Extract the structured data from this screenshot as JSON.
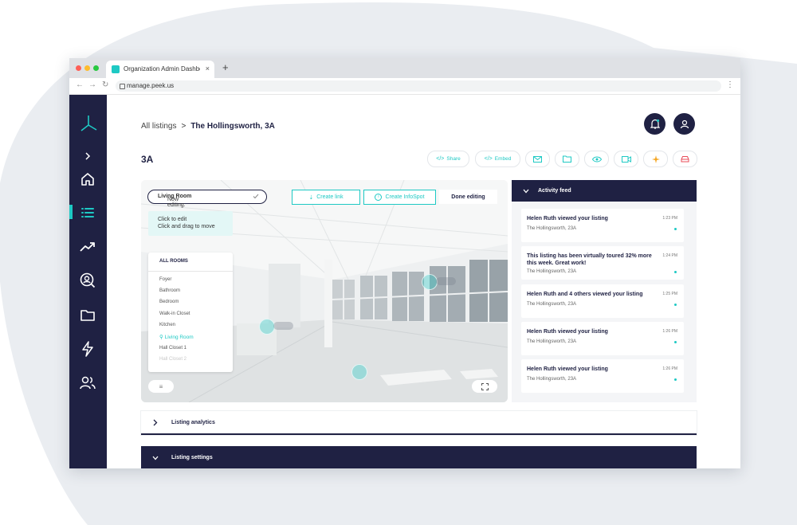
{
  "browser": {
    "tab_title": "Organization Admin Dashbo",
    "tab_close": "×",
    "new_tab": "+",
    "url": "manage.peek.us",
    "menu": "⋮"
  },
  "sidebar": {
    "items": [
      {
        "icon": "chevron-right-icon"
      },
      {
        "icon": "home-icon"
      },
      {
        "icon": "list-icon",
        "active": true
      },
      {
        "icon": "trending-up-icon"
      },
      {
        "icon": "search-user-icon"
      },
      {
        "icon": "folder-icon"
      },
      {
        "icon": "lightning-icon"
      },
      {
        "icon": "users-icon"
      }
    ]
  },
  "header": {
    "breadcrumb_root": "All listings",
    "breadcrumb_sep": ">",
    "breadcrumb_current": "The Hollingsworth, 3A",
    "page_title": "3A"
  },
  "toolbar": {
    "share_label": "Share",
    "embed_label": "Embed"
  },
  "viewer": {
    "editing_prefix": "Now editing:",
    "editing_room": "Living Room",
    "create_link": "Create link",
    "create_infospot": "Create InfoSpot",
    "done_editing": "Done editing",
    "tip_line1": "Click to edit",
    "tip_line2": "Click and drag to move",
    "rooms_header": "ALL ROOMS",
    "rooms": [
      "Foyer",
      "Bathroom",
      "Bedroom",
      "Walk-in Closet",
      "Kitchen",
      "Living Room",
      "Hall Closet 1",
      "Hall Closet 2"
    ],
    "active_room_index": 5
  },
  "activity_feed": {
    "title": "Activity feed",
    "items": [
      {
        "text": "Helen Ruth viewed your listing",
        "sub": "The Hollingsworth, 23A",
        "time": "1:23 PM"
      },
      {
        "text": "This listing has been virtually toured 32% more this week. Great work!",
        "sub": "The Hollingsworth, 23A",
        "time": "1:24 PM"
      },
      {
        "text": "Helen Ruth and 4 others viewed your listing",
        "sub": "The Hollingsworth, 23A",
        "time": "1:25 PM"
      },
      {
        "text": "Helen Ruth viewed your listing",
        "sub": "The Hollingsworth, 23A",
        "time": "1:26 PM"
      },
      {
        "text": "Helen Ruth viewed your listing",
        "sub": "The Hollingsworth, 23A",
        "time": "1:26 PM"
      }
    ]
  },
  "sections": {
    "analytics_label": "Listing analytics",
    "settings_label": "Listing settings"
  },
  "colors": {
    "navy": "#1f2143",
    "accent": "#1ec9c4"
  }
}
